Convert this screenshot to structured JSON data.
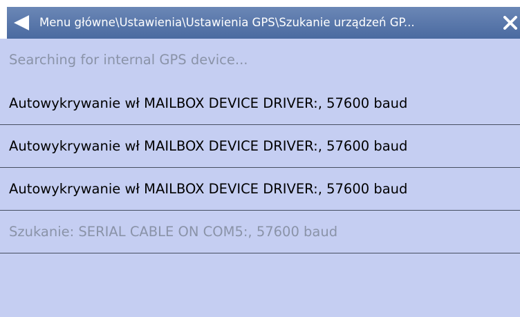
{
  "header": {
    "title": "Menu główne\\Ustawienia\\Ustawienia GPS\\Szukanie urządzeń GP...",
    "back_icon": "back-arrow-icon",
    "close_icon": "close-icon"
  },
  "status": {
    "text": "Searching for internal GPS device..."
  },
  "devices": [
    {
      "label": "Autowykrywanie wł MAILBOX DEVICE DRIVER:, 57600 baud",
      "state": "active"
    },
    {
      "label": "Autowykrywanie wł MAILBOX DEVICE DRIVER:, 57600 baud",
      "state": "active"
    },
    {
      "label": "Autowykrywanie wł MAILBOX DEVICE DRIVER:, 57600 baud",
      "state": "active"
    },
    {
      "label": "Szukanie: SERIAL CABLE ON COM5:, 57600 baud",
      "state": "dimmed"
    }
  ],
  "colors": {
    "background": "#c5cef2",
    "header": "#5a78aa",
    "dimmed_text": "#8a93a8",
    "separator": "#454d60"
  }
}
